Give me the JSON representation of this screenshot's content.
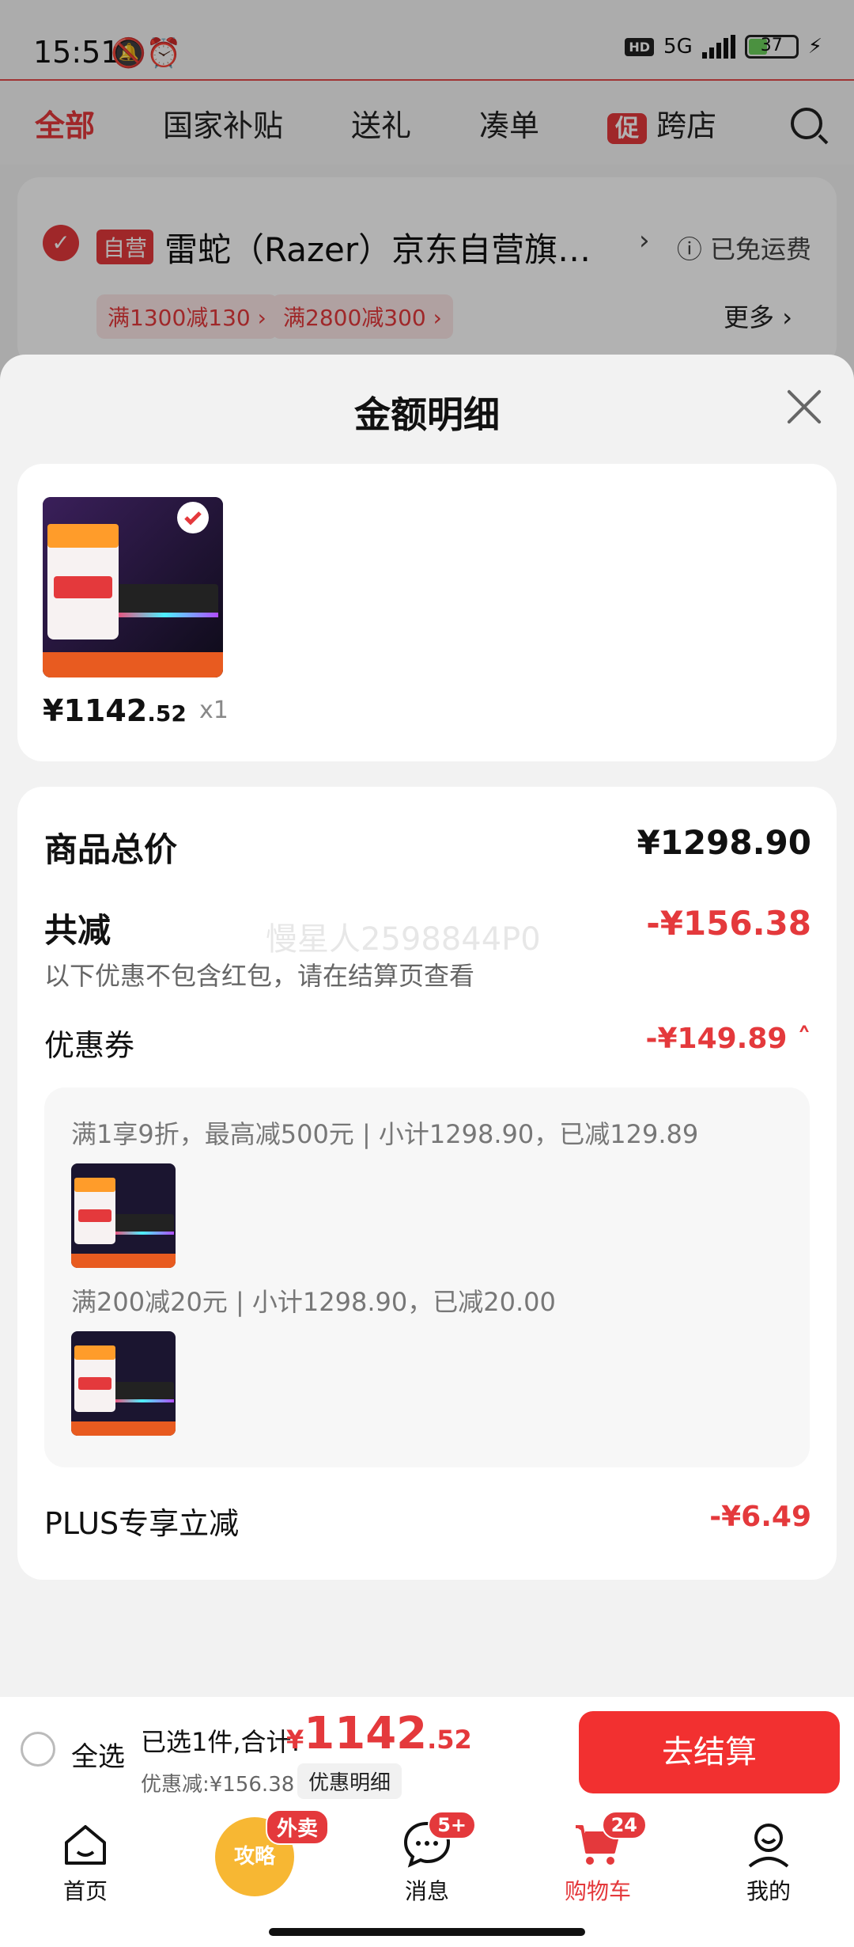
{
  "status_bar": {
    "time": "15:51",
    "network": "5G",
    "battery": "37",
    "battery_level": 0.37
  },
  "top_tabs": [
    "全部",
    "国家补贴",
    "送礼",
    "凑单",
    "跨店"
  ],
  "top_tabs_active": "全部",
  "promo_badge": "促",
  "store": {
    "self_badge": "自营",
    "name": "雷蛇（Razer）京东自营旗…",
    "free_shipping": "ⓘ 已免运费",
    "coupons": [
      "满1300减130 ›",
      "满2800减300 ›"
    ],
    "more": "更多 ›"
  },
  "sheet": {
    "title": "金额明细",
    "product": {
      "price_main": "¥1142",
      "price_frac": ".52",
      "qty": "x1"
    },
    "total_label": "商品总价",
    "total_value": "¥1298.90",
    "discount_label": "共减",
    "discount_value": "-¥156.38",
    "watermark": "慢星人2598844P0",
    "discount_note": "以下优惠不包含红包，请在结算页查看",
    "coupon_label": "优惠券",
    "coupon_value": "-¥149.89 ˄",
    "rules": [
      "满1享9折，最高减500元 | 小计1298.90，已减129.89",
      "满200减20元 | 小计1298.90，已减20.00"
    ],
    "plus_label": "PLUS专享立减",
    "plus_value": "-¥6.49"
  },
  "checkout": {
    "select_all": "全选",
    "selected_summary": "已选1件,合计:",
    "total_yen": "¥",
    "total_main": "1142",
    "total_frac": ".52",
    "discount_summary": "优惠减:¥156.38",
    "detail_chip": "优惠明细",
    "button": "去结算"
  },
  "nav": {
    "home": "首页",
    "gonglue": "攻略",
    "waimai": "外卖",
    "messages": "消息",
    "messages_badge": "5+",
    "cart": "购物车",
    "cart_badge": "24",
    "mine": "我的"
  },
  "colors": {
    "accent": "#e4393c",
    "checkout_button": "#f23030"
  }
}
